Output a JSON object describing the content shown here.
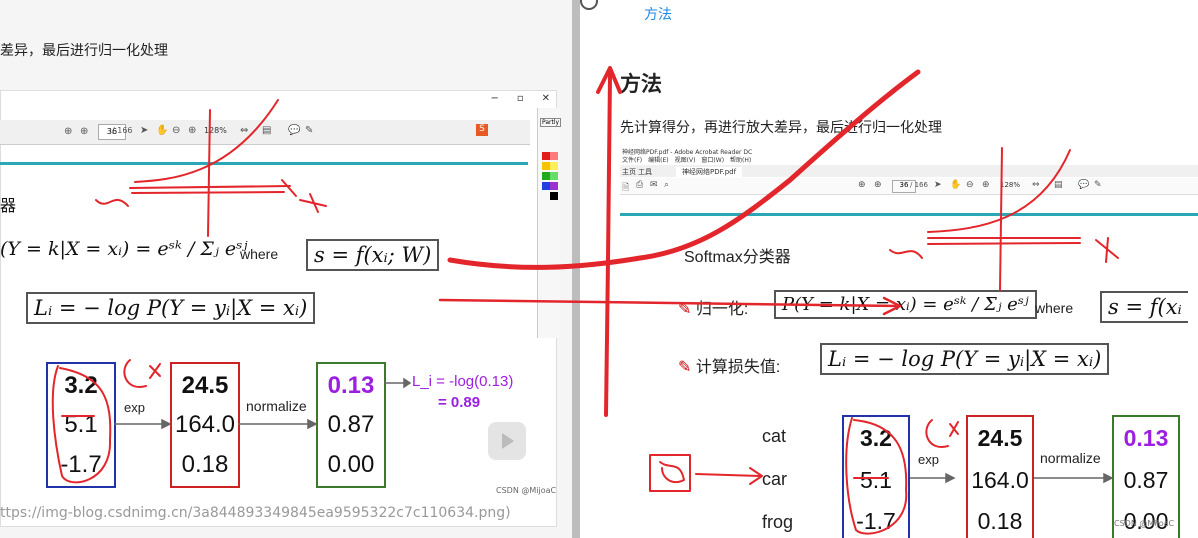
{
  "left": {
    "text_line": "差异，最后进行归一化处理",
    "window_controls": [
      "−",
      "▫",
      "✕"
    ],
    "pdf_toolbar": {
      "page": "36",
      "total": "/ 166",
      "zoom": "128%"
    },
    "side_panel": {
      "title": "Partly"
    },
    "header_cut": "器",
    "where_label": "where",
    "formula_prob": "(Y = k|X = xᵢ) = eˢᵏ / Σⱼ eˢʲ",
    "formula_score": "s = f(xᵢ; W)",
    "formula_loss": "Lᵢ = − log P(Y = yᵢ|X = xᵢ)",
    "raw_scores": [
      "3.2",
      "5.1",
      "-1.7"
    ],
    "exp_label": "exp",
    "exp_scores": [
      "24.5",
      "164.0",
      "0.18"
    ],
    "normalize_label": "normalize",
    "probs": [
      "0.13",
      "0.87",
      "0.00"
    ],
    "loss_line1": "L_i = -log(0.13)",
    "loss_line2": "= 0.89",
    "watermark": "CSDN @MijoaC",
    "url": "ttps://img-blog.csdnimg.cn/3a844893349845ea9595322c7c110634.png)"
  },
  "right": {
    "top_link": "方法",
    "heading": "方法",
    "paragraph": "先计算得分，再进行放大差异，最后进行归一化处理",
    "pdf_title": "神经网络PDF.pdf - Adobe Acrobat Reader DC",
    "pdf_menu": [
      "文件(F)",
      "编辑(E)",
      "视图(V)",
      "窗口(W)",
      "帮助(H)"
    ],
    "pdf_tabs": [
      "主页",
      "工具",
      "神经网络PDF.pdf"
    ],
    "pdf_toolbar": {
      "page": "36",
      "total": "/ 166",
      "zoom": "128%"
    },
    "softmax_label": "Softmax分类器",
    "normalize_item": "归一化:",
    "loss_item": "计算损失值:",
    "where_label": "where",
    "formula_prob": "P(Y = k|X = xᵢ) = eˢᵏ / Σⱼ eˢʲ",
    "formula_score": "s = f(xᵢ",
    "formula_loss": "Lᵢ = − log P(Y = yᵢ|X = xᵢ)",
    "classes": [
      "cat",
      "car",
      "frog"
    ],
    "raw_scores": [
      "3.2",
      "5.1",
      "-1.7"
    ],
    "exp_label": "exp",
    "exp_scores": [
      "24.5",
      "164.0",
      "0.18"
    ],
    "normalize_label": "normalize",
    "probs": [
      "0.13",
      "0.87",
      "0.00"
    ],
    "watermark": "CSDN @MijoaC"
  },
  "annotations": {
    "ink_color": "#e3262b",
    "ex_label": "eˣ"
  },
  "colors": {
    "blue_box": "#2233aa",
    "red_box": "#cc2222",
    "green_box": "#3a7a2a",
    "purple_text": "#9b1fe0",
    "link": "#1e88e5",
    "teal": "#2aa8b8"
  }
}
